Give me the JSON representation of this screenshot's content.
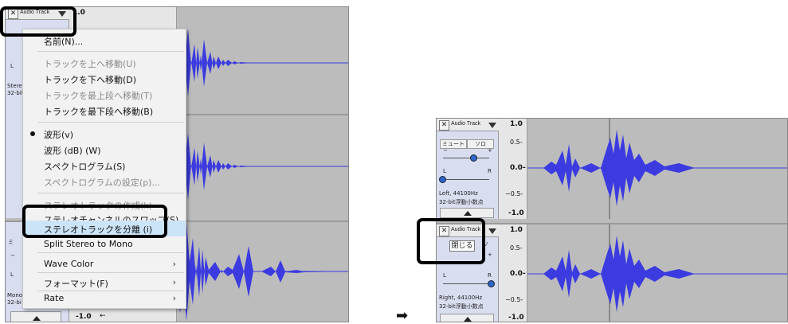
{
  "left_panel": {
    "track_top": {
      "name": "Audio Track",
      "scale_label": "1.0",
      "bits_partial": "32-bit",
      "stereo_partial": "Stere"
    },
    "track_bottom": {
      "mono_partial": "Mono",
      "bits_partial": "32-bi",
      "mute_partial": "ミ",
      "ruler_value": "-1.0",
      "arrow_glyph": "←"
    },
    "context_menu": {
      "items": [
        {
          "label": "名前(N)...",
          "disabled": false
        },
        {
          "label": "トラックを上へ移動(U)",
          "disabled": true
        },
        {
          "label": "トラックを下へ移動(D)",
          "disabled": false
        },
        {
          "label": "トラックを最上段へ移動(T)",
          "disabled": true
        },
        {
          "label": "トラックを最下段へ移動(B)",
          "disabled": false
        },
        {
          "label": "波形(v)",
          "disabled": false,
          "checked": true
        },
        {
          "label": "波形 (dB) (W)",
          "disabled": false
        },
        {
          "label": "スペクトログラム(S)",
          "disabled": false
        },
        {
          "label": "スペクトログラムの設定(p)...",
          "disabled": true
        },
        {
          "label": "ステレオトラックの作成(k)",
          "disabled": true
        },
        {
          "label": "ステレオチャンネルのスワップ(S)",
          "disabled": false
        },
        {
          "label": "ステレオトラックを分離 (i)",
          "disabled": false,
          "highlighted": true
        },
        {
          "label": "Split Stereo to Mono",
          "disabled": false
        },
        {
          "label": "Wave Color",
          "disabled": false,
          "submenu": true
        },
        {
          "label": "フォーマット(F)",
          "disabled": false,
          "submenu": true
        },
        {
          "label": "Rate",
          "disabled": false,
          "submenu": true
        }
      ]
    }
  },
  "right_panel": {
    "track_upper": {
      "name": "Audio Track",
      "mute": "ミュート",
      "solo": "ソロ",
      "gain_minus": "−",
      "gain_plus": "+",
      "pan_left": "L",
      "pan_right": "R",
      "info_line1": "Left, 44100Hz",
      "info_line2": "32-bit浮動小数点",
      "ruler": {
        "top": "1.0",
        "upper": "0.5-",
        "mid": "0.0-",
        "lower": "−0.5-",
        "bottom": "-1.0"
      }
    },
    "track_lower": {
      "name": "Audio Track",
      "tooltip": "閉じる",
      "solo_partial": "ソ",
      "gain_plus": "+",
      "pan_left": "L",
      "pan_right": "R",
      "info_line1": "Right, 44100Hz",
      "info_line2": "32-bit浮動小数点",
      "ruler": {
        "top": "1.0",
        "upper": "0.5-",
        "mid": "0.0-",
        "lower": "−0.5-",
        "bottom": "-1.0"
      }
    }
  },
  "arrow_between": "➡",
  "colors": {
    "waveform": "#3b3be0",
    "wave_bg": "#bcbcbc",
    "control_panel": "#d9ddf0",
    "highlight": "#cce4f7",
    "callout": "#000000"
  }
}
